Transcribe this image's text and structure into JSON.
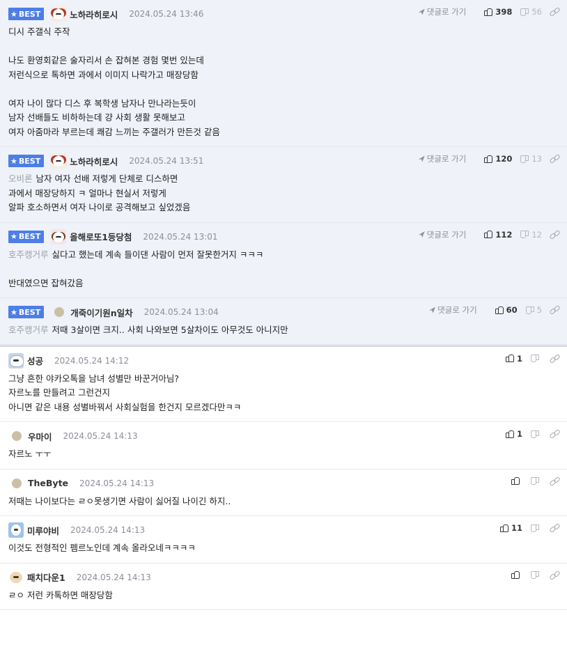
{
  "comments": [
    {
      "best": true,
      "best_label": "BEST",
      "avatar": "av-dog red",
      "nick": "노하라히로시",
      "date": "2024.05.24 13:46",
      "reply_link": "댓글로 가기",
      "up": "398",
      "down": "56",
      "lines": [
        "디시 주갤식 주작",
        "",
        "나도 환영회같은 술자리서 손 잡혀본 경험 몇번 있는데",
        "저런식으로 톡하면 과에서 이미지 나락가고 매장당함",
        "",
        "여자 나이 많다 디스 후 복학생 남자나 만나라는듯이",
        "남자 선배들도 비하하는데 걍 사회 생활 못해보고",
        "여자 아줌마라 부르는데 쾌감 느끼는 주갤러가 만든것 같음"
      ],
      "tag": ""
    },
    {
      "best": true,
      "best_label": "BEST",
      "avatar": "av-dog red",
      "nick": "노하라히로시",
      "date": "2024.05.24 13:51",
      "reply_link": "댓글로 가기",
      "up": "120",
      "down": "13",
      "tag": "오비론",
      "lines": [
        "남자 여자 선배 저렇게 단체로 디스하면",
        "과에서 매장당하지 ㅋ 얼마나 현실서 저렇게",
        "알파 호소하면서 여자 나이로 공격해보고 싶었겠음"
      ]
    },
    {
      "best": true,
      "best_label": "BEST",
      "avatar": "av-dog pink",
      "nick": "올해로또1등당첨",
      "date": "2024.05.24 13:01",
      "reply_link": "댓글로 가기",
      "up": "112",
      "down": "12",
      "tag": "호주캥거루",
      "lines": [
        "싫다고 했는데 계속 들이댄 사람이 먼저 잘못한거지 ㅋㅋㅋ",
        "",
        "반대였으면 잡혀갔음"
      ]
    },
    {
      "best": true,
      "best_label": "BEST",
      "avatar": "av-blob small",
      "nick": "개죽이기원n일차",
      "date": "2024.05.24 13:04",
      "reply_link": "댓글로 가기",
      "up": "60",
      "down": "5",
      "tag": "호주캥거루",
      "lines": [
        "저때 3살이면 크지.. 사회 나와보면 5살차이도 아무것도 아니지만"
      ]
    },
    {
      "best": false,
      "avatar": "av-sheep",
      "nick": "성공",
      "date": "2024.05.24 14:12",
      "reply_link": "",
      "up": "1",
      "down": "",
      "tag": "",
      "lines": [
        "그냥 흔한 야카오톡을 남녀 성별만 바꾼거아님?",
        "자르노를 만들려고 그런건지",
        "아니면 같은 내용 성별바꿔서 사회실험을 한건지 모르겠다만ㅋㅋ"
      ]
    },
    {
      "best": false,
      "avatar": "av-blob small",
      "nick": "우마이",
      "date": "2024.05.24 14:13",
      "reply_link": "",
      "up": "1",
      "down": "",
      "tag": "",
      "lines": [
        "자르노 ㅜㅜ"
      ]
    },
    {
      "best": false,
      "avatar": "av-blob small",
      "nick": "TheByte",
      "date": "2024.05.24 14:13",
      "reply_link": "",
      "up": "",
      "down": "",
      "tag": "",
      "lines": [
        "저때는 나이보다는 ㄹㅇ못생기면 사람이 싫어질 나이긴 하지.."
      ]
    },
    {
      "best": false,
      "avatar": "av-blue",
      "nick": "미루야비",
      "date": "2024.05.24 14:13",
      "reply_link": "",
      "up": "11",
      "down": "",
      "tag": "",
      "lines": [
        "이것도 전형적인 펨르노인데 계속 올라오네ㅋㅋㅋㅋ"
      ]
    },
    {
      "best": false,
      "avatar": "av-puppy",
      "nick": "패치다운1",
      "date": "2024.05.24 14:13",
      "reply_link": "",
      "up": "",
      "down": "",
      "tag": "",
      "lines": [
        "ㄹㅇ 저런 카톡하면 매장당함"
      ]
    }
  ]
}
